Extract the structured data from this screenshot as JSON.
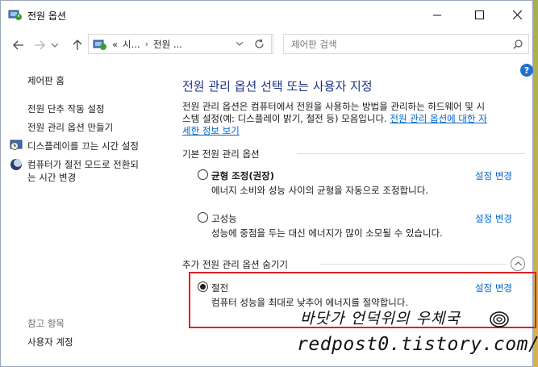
{
  "window": {
    "title": "전원 옵션",
    "minimize_icon": "minimize-icon",
    "maximize_icon": "maximize-icon",
    "close_icon": "close-icon"
  },
  "nav": {
    "breadcrumb": [
      "«",
      "시...",
      "›",
      "전원 ..."
    ],
    "search_placeholder": "제어판 검색"
  },
  "sidebar": {
    "home": "제어판 홈",
    "links": [
      "전원 단추 작동 설정",
      "전원 관리 옵션 만들기",
      "디스플레이를 끄는 시간 설정",
      "컴퓨터가 절전 모드로 전환되",
      "는 시간 변경"
    ],
    "see_also": "참고 항목",
    "user_accounts": "사용자 계정"
  },
  "main": {
    "title": "전원 관리 옵션 선택 또는 사용자 지정",
    "description_line1": "전원 관리 옵션은 컴퓨터에서 전원을 사용하는 방법을 관리하는 하드웨어 및 시",
    "description_line2": "스템 설정(예: 디스플레이 밝기, 절전 등) 모음입니다. ",
    "description_link1": "전원 관리 옵션에 대한 자",
    "description_link2": "세한 정보 보기",
    "basic_header": "기본 전원 관리 옵션",
    "extra_header": "추가 전원 관리 옵션 숨기기",
    "change_label": "설정 변경",
    "plans": [
      {
        "name": "균형 조정(권장)",
        "desc": "에너지 소비와 성능 사이의 균형을 자동으로 조정합니다.",
        "selected": false
      },
      {
        "name": "고성능",
        "desc": "성능에 중점을 두는 대신 에너지가 많이 소모될 수 있습니다.",
        "selected": false
      },
      {
        "name": "절전",
        "desc": "컴퓨터 성능을 최대로 낮추어 에너지를 절약합니다.",
        "selected": true
      }
    ]
  },
  "watermark": {
    "name": "바닷가 언덕위의 우체국",
    "url": "redpost0.tistory.com/"
  },
  "colors": {
    "title_blue": "#1e3287",
    "link_blue": "#0066cc",
    "highlight_red": "#e02020"
  }
}
